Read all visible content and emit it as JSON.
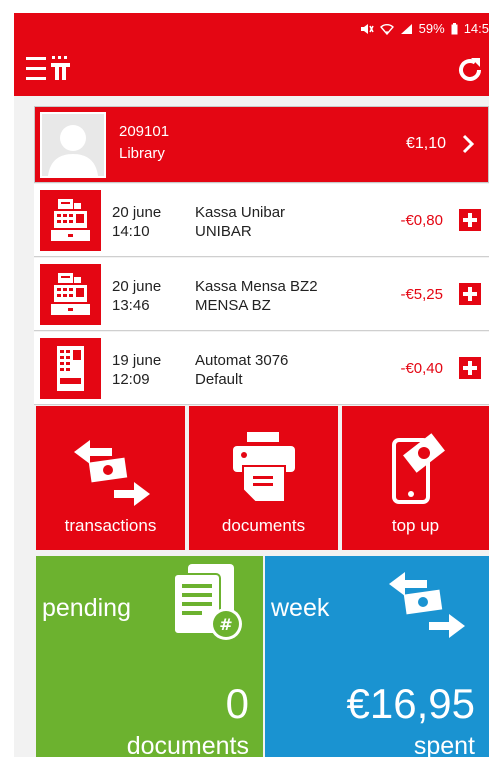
{
  "status": {
    "battery": "59%",
    "time": "14:5"
  },
  "account": {
    "id": "209101",
    "name": "Library",
    "balance": "€1,10"
  },
  "transactions": [
    {
      "date": "20 june",
      "time": "14:10",
      "title": "Kassa Unibar",
      "place": "UNIBAR",
      "amount": "-€0,80",
      "icon": "cash-register-icon"
    },
    {
      "date": "20 june",
      "time": "13:46",
      "title": "Kassa Mensa BZ2",
      "place": "MENSA BZ",
      "amount": "-€5,25",
      "icon": "cash-register-icon"
    },
    {
      "date": "19 june",
      "time": "12:09",
      "title": "Automat 3076",
      "place": "Default",
      "amount": "-€0,40",
      "icon": "vending-machine-icon"
    }
  ],
  "tiles": {
    "transactions": "transactions",
    "documents": "documents",
    "topup": "top up"
  },
  "pending": {
    "head": "pending",
    "count": "0",
    "unit": "documents"
  },
  "week": {
    "head": "week",
    "amount": "€16,95",
    "unit": "spent"
  },
  "colors": {
    "brand": "#e40613",
    "green": "#6cb22f",
    "blue": "#1a93d1"
  }
}
